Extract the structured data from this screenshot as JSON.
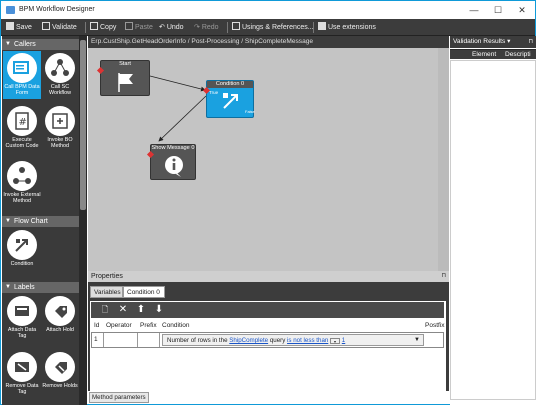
{
  "window": {
    "title": "BPM Workflow Designer",
    "controls": [
      "—",
      "☐",
      "✕"
    ]
  },
  "toolbar": {
    "save": "Save",
    "validate": "Validate",
    "copy": "Copy",
    "paste": "Paste",
    "undo": "Undo",
    "redo": "Redo",
    "usings": "Usings & References...",
    "extensions": "Use extensions"
  },
  "left": {
    "callers_header": "Callers",
    "callers": [
      "Call BPM Data Form",
      "Call SC Workflow",
      "Execute Custom Code",
      "Invoke BO Method",
      "Invoke External Method"
    ],
    "flowchart_header": "Flow Chart",
    "flowchart": [
      "Condition"
    ],
    "labels_header": "Labels",
    "labels": [
      "Attach Data Tag",
      "Attach Hold",
      "Remove Data Tag",
      "Remove Holds"
    ]
  },
  "canvas": {
    "breadcrumb": "Erp.CustShip.GetHeadOrderInfo / Post-Processing / ShipCompleteMessage",
    "nodes": {
      "start": "Start",
      "condition": "Condition 0",
      "true_label": "True",
      "false_label": "False",
      "message": "Show Message 0"
    }
  },
  "properties": {
    "title": "Properties",
    "pin": "⊓",
    "tabs": [
      "Variables",
      "Condition 0"
    ],
    "buttons": [
      "🗋",
      "✕",
      "⬆",
      "⬇"
    ],
    "columns": [
      "Id",
      "Operator",
      "Prefix",
      "Condition",
      "Postfix"
    ],
    "row": {
      "id": "1",
      "operator": "",
      "prefix": "",
      "condition_pre": "Number of rows in the ",
      "condition_link1": "ShipComplete",
      "condition_mid": " query ",
      "condition_link2": "is not less than",
      "condition_post": " ",
      "condition_link3": "1",
      "postfix": ""
    }
  },
  "bottom_tab": "Method parameters",
  "validation": {
    "title": "Validation Results ▾",
    "pin": "⊓",
    "columns": [
      "Element",
      "Descripti"
    ]
  }
}
